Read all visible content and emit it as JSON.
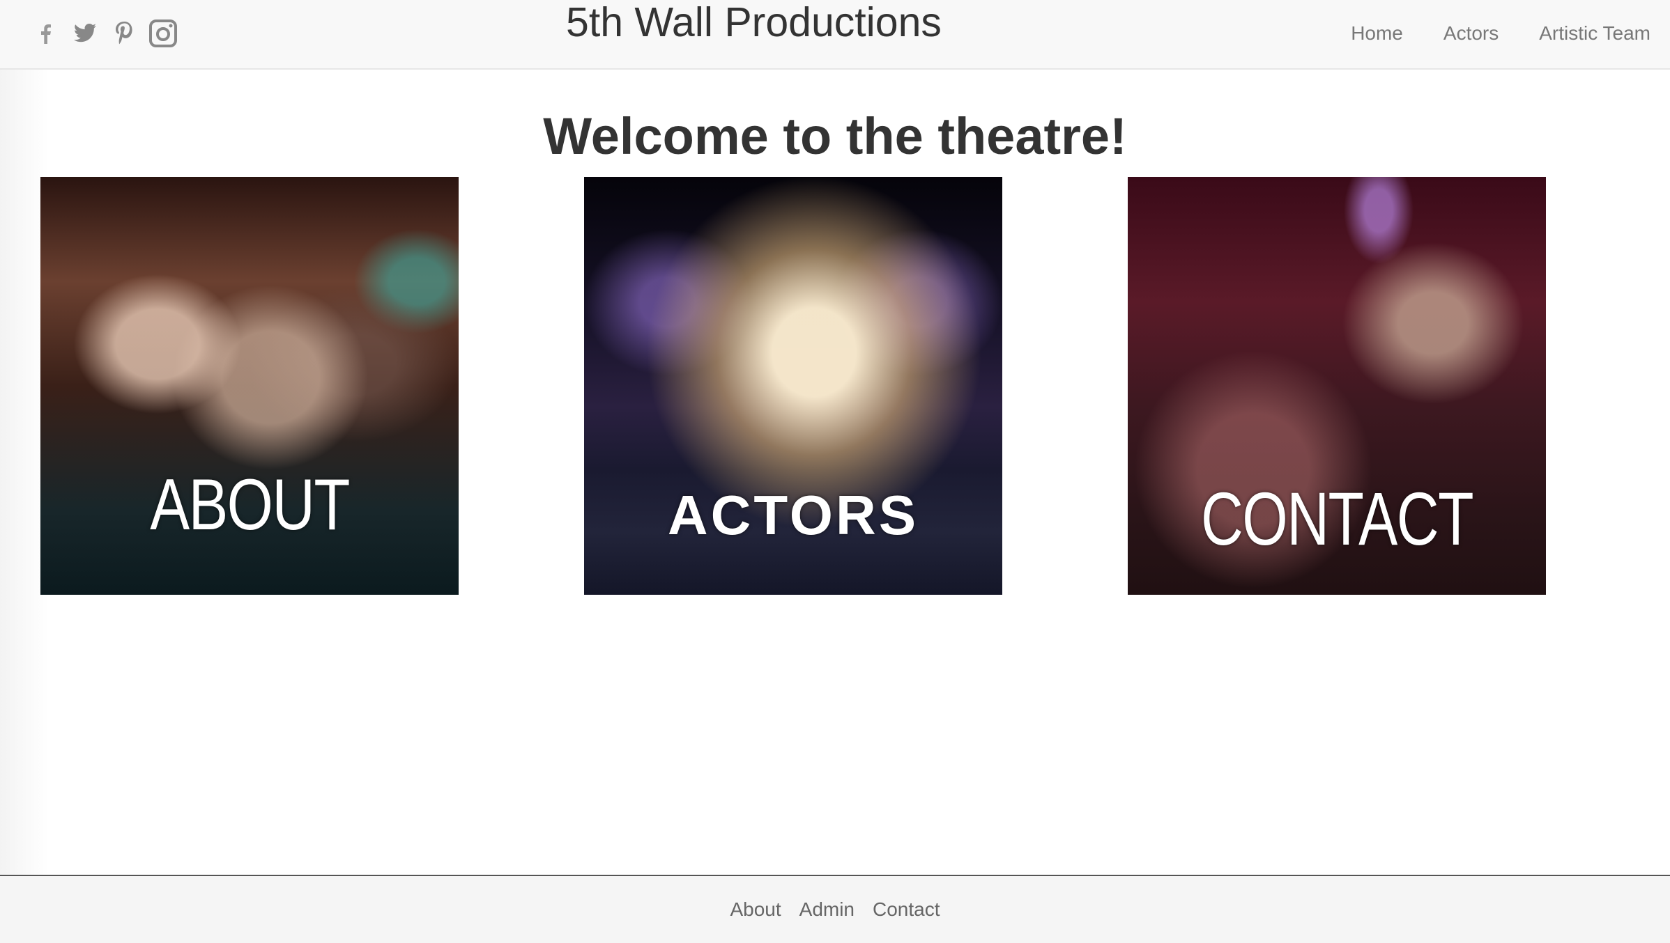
{
  "header": {
    "brand": "5th Wall Productions",
    "social_icons": [
      "facebook-icon",
      "twitter-icon",
      "pinterest-icon",
      "instagram-icon"
    ],
    "nav": [
      {
        "label": "Home"
      },
      {
        "label": "Actors"
      },
      {
        "label": "Artistic Team"
      }
    ]
  },
  "main": {
    "welcome": "Welcome to the theatre!",
    "cards": [
      {
        "label": "ABOUT"
      },
      {
        "label": "ACTORS"
      },
      {
        "label": "CONTACT"
      }
    ]
  },
  "footer": {
    "links": [
      {
        "label": "About"
      },
      {
        "label": "Admin"
      },
      {
        "label": "Contact"
      }
    ]
  },
  "colors": {
    "navbar_bg": "#f8f8f8",
    "text_dark": "#333333",
    "nav_text": "#777777",
    "footer_bg": "#f5f5f5"
  }
}
